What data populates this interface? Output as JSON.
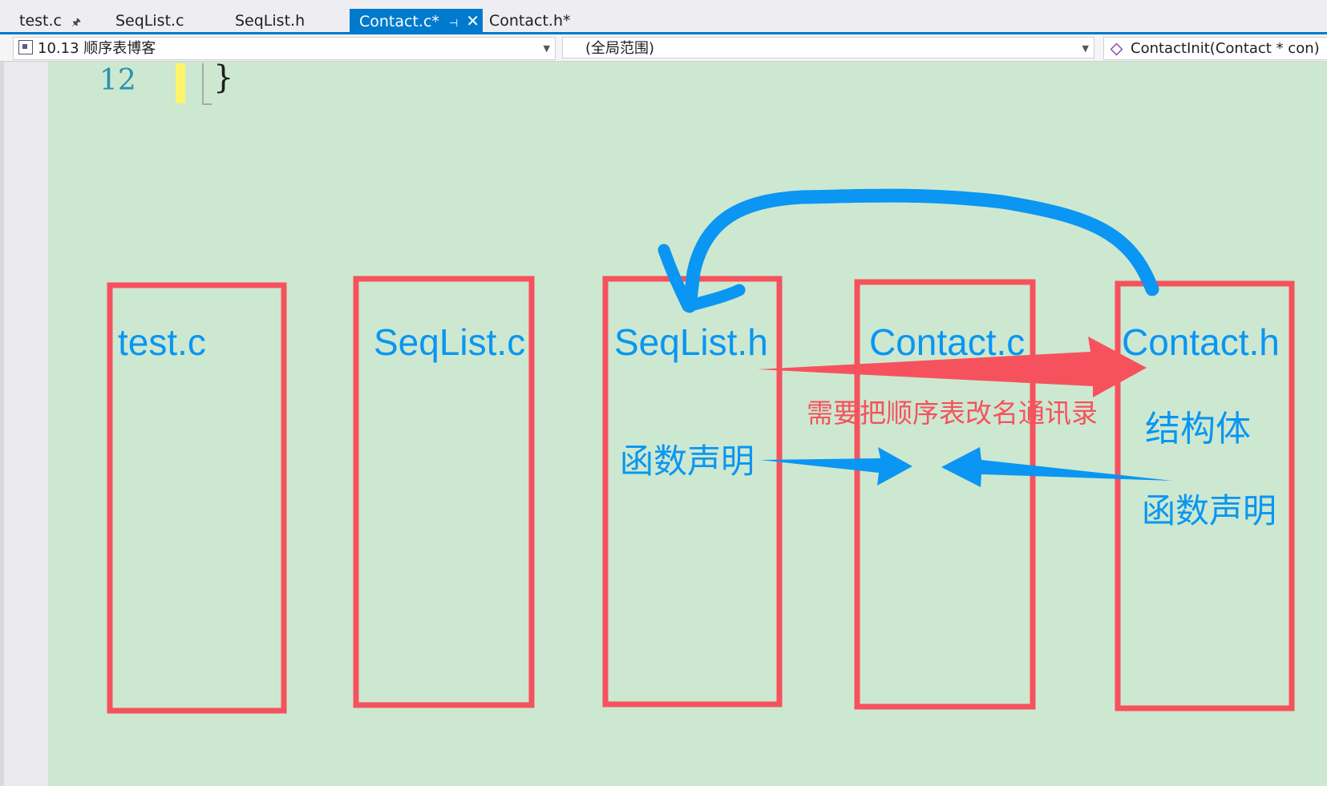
{
  "tabs": [
    {
      "label": "test.c",
      "pinned": true
    },
    {
      "label": "SeqList.c"
    },
    {
      "label": "SeqList.h"
    },
    {
      "label": "Contact.c*",
      "active": true,
      "pinned": true,
      "closable": true
    },
    {
      "label": "Contact.h*"
    }
  ],
  "navbar": {
    "project": "10.13 顺序表博客",
    "scope": "(全局范围)",
    "member": "ContactInit(Contact * con)"
  },
  "editor": {
    "line_number": "12",
    "code": "}",
    "background": "#cde8d0"
  },
  "annotation": {
    "box_color": "#f5525e",
    "text_blue": "#0a96f2",
    "boxes": [
      "test.c",
      "SeqList.c",
      "SeqList.h",
      "Contact.c",
      "Contact.h"
    ],
    "red_note": "需要把顺序表改名通讯录",
    "struct_label": "结构体",
    "func_decl_left": "函数声明",
    "func_decl_right": "函数声明"
  }
}
